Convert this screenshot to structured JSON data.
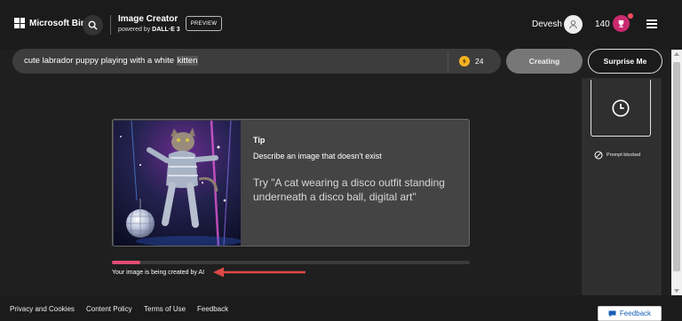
{
  "header": {
    "logo_text": "Microsoft Bing",
    "app_title": "Image Creator",
    "powered_by": "powered by",
    "powered_by_brand": "DALL·E 3",
    "preview_badge": "PREVIEW",
    "user_name": "Devesh",
    "reward_count": "140",
    "icons": [
      "windows-logo-icon",
      "search-icon",
      "avatar-icon",
      "reward-trophy-icon",
      "hamburger-menu-icon"
    ]
  },
  "prompt": {
    "text_before": "cute labrador puppy playing with a white ",
    "text_highlight": "kitten",
    "boost_count": "24",
    "creating_label": "Creating",
    "surprise_label": "Surprise Me"
  },
  "history": {
    "blocked_label": "Prompt blocked",
    "icons": [
      "clock-icon",
      "blocked-icon"
    ]
  },
  "tip": {
    "label": "Tip",
    "description": "Describe an image that doesn't exist",
    "example": "Try \"A cat wearing a disco outfit standing underneath a disco ball, digital art\""
  },
  "progress": {
    "fraction": 0.08,
    "text": "Your image is being created by AI"
  },
  "footer": {
    "links": [
      "Privacy and Cookies",
      "Content Policy",
      "Terms of Use",
      "Feedback"
    ],
    "feedback_button": "Feedback"
  },
  "colors": {
    "background": "#1f1f1f",
    "progress": "#e24b73",
    "annotation_arrow": "#e04848",
    "reward": "#c92a6e",
    "boost_coin": "#f5b324"
  }
}
